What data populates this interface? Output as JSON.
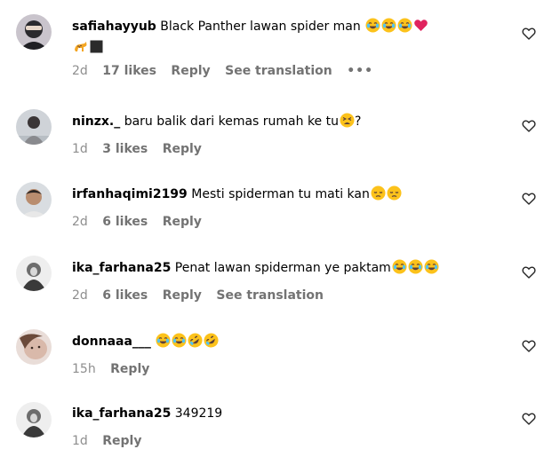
{
  "comments": [
    {
      "username": "safiahayyub",
      "text": "Black Panther lawan spider man",
      "emojis": [
        "joy-emoji",
        "joy-emoji",
        "joy-emoji",
        "red-heart-emoji"
      ],
      "extra_emojis": [
        "leopard-emoji",
        "black-square-emoji"
      ],
      "time": "2d",
      "likes": "17 likes",
      "reply": "Reply",
      "translate": "See translation",
      "more": "•••"
    },
    {
      "username": "ninzx._",
      "text": "baru balik dari kemas rumah ke tu",
      "emojis": [
        "tired-face-emoji"
      ],
      "suffix": "?",
      "time": "1d",
      "likes": "3 likes",
      "reply": "Reply"
    },
    {
      "username": "irfanhaqimi2199",
      "text": "Mesti spiderman tu mati kan",
      "emojis": [
        "pensive-emoji",
        "pensive-emoji"
      ],
      "time": "2d",
      "likes": "6 likes",
      "reply": "Reply"
    },
    {
      "username": "ika_farhana25",
      "text": "Penat lawan spiderman ye paktam",
      "emojis": [
        "joy-emoji",
        "joy-emoji",
        "joy-emoji"
      ],
      "time": "2d",
      "likes": "6 likes",
      "reply": "Reply",
      "translate": "See translation"
    },
    {
      "username": "donnaaa___",
      "text": "",
      "emojis": [
        "joy-emoji",
        "joy-emoji",
        "rofl-emoji",
        "rofl-emoji"
      ],
      "time": "15h",
      "reply": "Reply"
    },
    {
      "username": "ika_farhana25",
      "text": "349219",
      "emojis": [],
      "time": "1d",
      "reply": "Reply"
    }
  ],
  "colors": {
    "meta": "#737373",
    "heart_outline": "#262626",
    "emoji_yellow": "#fcc21b",
    "emoji_tear": "#4fc3f7",
    "red_heart": "#e0245e"
  }
}
